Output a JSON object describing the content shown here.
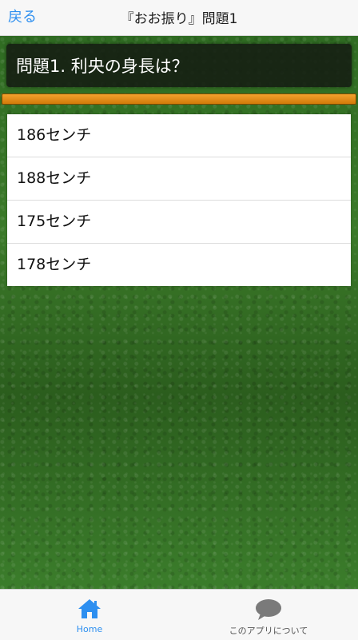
{
  "navbar": {
    "back_label": "戻る",
    "title": "『おお振り』問題1"
  },
  "question": {
    "text": "問題1. 利央の身長は？"
  },
  "answers": [
    {
      "label": "186センチ"
    },
    {
      "label": "188センチ"
    },
    {
      "label": "175センチ"
    },
    {
      "label": "178センチ"
    }
  ],
  "tabbar": {
    "home_label": "Home",
    "about_label": "このアプリについて"
  },
  "colors": {
    "accent": "#2d8ff0",
    "progress": "#e8921a"
  },
  "icons": {
    "home": "home-icon",
    "about": "speech-bubble-icon"
  }
}
